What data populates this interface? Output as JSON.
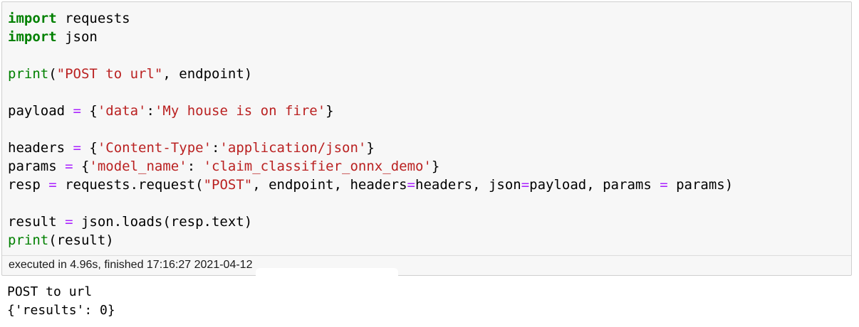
{
  "cell": {
    "code_lines": [
      [
        {
          "t": "kw",
          "v": "import"
        },
        {
          "t": "plain",
          "v": " requests"
        }
      ],
      [
        {
          "t": "kw",
          "v": "import"
        },
        {
          "t": "plain",
          "v": " json"
        }
      ],
      [],
      [
        {
          "t": "bi",
          "v": "print"
        },
        {
          "t": "plain",
          "v": "("
        },
        {
          "t": "str",
          "v": "\"POST to url\""
        },
        {
          "t": "plain",
          "v": ", endpoint)"
        }
      ],
      [],
      [
        {
          "t": "plain",
          "v": "payload "
        },
        {
          "t": "op",
          "v": "="
        },
        {
          "t": "plain",
          "v": " {"
        },
        {
          "t": "str",
          "v": "'data'"
        },
        {
          "t": "plain",
          "v": ":"
        },
        {
          "t": "str",
          "v": "'My house is on fire'"
        },
        {
          "t": "plain",
          "v": "}"
        }
      ],
      [],
      [
        {
          "t": "plain",
          "v": "headers "
        },
        {
          "t": "op",
          "v": "="
        },
        {
          "t": "plain",
          "v": " {"
        },
        {
          "t": "str",
          "v": "'Content-Type'"
        },
        {
          "t": "plain",
          "v": ":"
        },
        {
          "t": "str",
          "v": "'application/json'"
        },
        {
          "t": "plain",
          "v": "}"
        }
      ],
      [
        {
          "t": "plain",
          "v": "params "
        },
        {
          "t": "op",
          "v": "="
        },
        {
          "t": "plain",
          "v": " {"
        },
        {
          "t": "str",
          "v": "'model_name'"
        },
        {
          "t": "plain",
          "v": ": "
        },
        {
          "t": "str",
          "v": "'claim_classifier_onnx_demo'"
        },
        {
          "t": "plain",
          "v": "}"
        }
      ],
      [
        {
          "t": "plain",
          "v": "resp "
        },
        {
          "t": "op",
          "v": "="
        },
        {
          "t": "plain",
          "v": " requests.request("
        },
        {
          "t": "str",
          "v": "\"POST\""
        },
        {
          "t": "plain",
          "v": ", endpoint, headers"
        },
        {
          "t": "op",
          "v": "="
        },
        {
          "t": "plain",
          "v": "headers, json"
        },
        {
          "t": "op",
          "v": "="
        },
        {
          "t": "plain",
          "v": "payload, params "
        },
        {
          "t": "op",
          "v": "="
        },
        {
          "t": "plain",
          "v": " params)"
        }
      ],
      [],
      [
        {
          "t": "plain",
          "v": "result "
        },
        {
          "t": "op",
          "v": "="
        },
        {
          "t": "plain",
          "v": " json.loads(resp.text)"
        }
      ],
      [
        {
          "t": "bi",
          "v": "print"
        },
        {
          "t": "plain",
          "v": "(result)"
        }
      ]
    ],
    "execution_info": "executed in 4.96s, finished 17:16:27 2021-04-12"
  },
  "output": {
    "lines": [
      "POST to url",
      "{'results': 0}"
    ]
  },
  "colors": {
    "keyword": "#008000",
    "builtin": "#008000",
    "string": "#ba2121",
    "operator": "#aa22ff",
    "cell_background": "#f7f7f7",
    "cell_border": "#cfcfcf"
  }
}
